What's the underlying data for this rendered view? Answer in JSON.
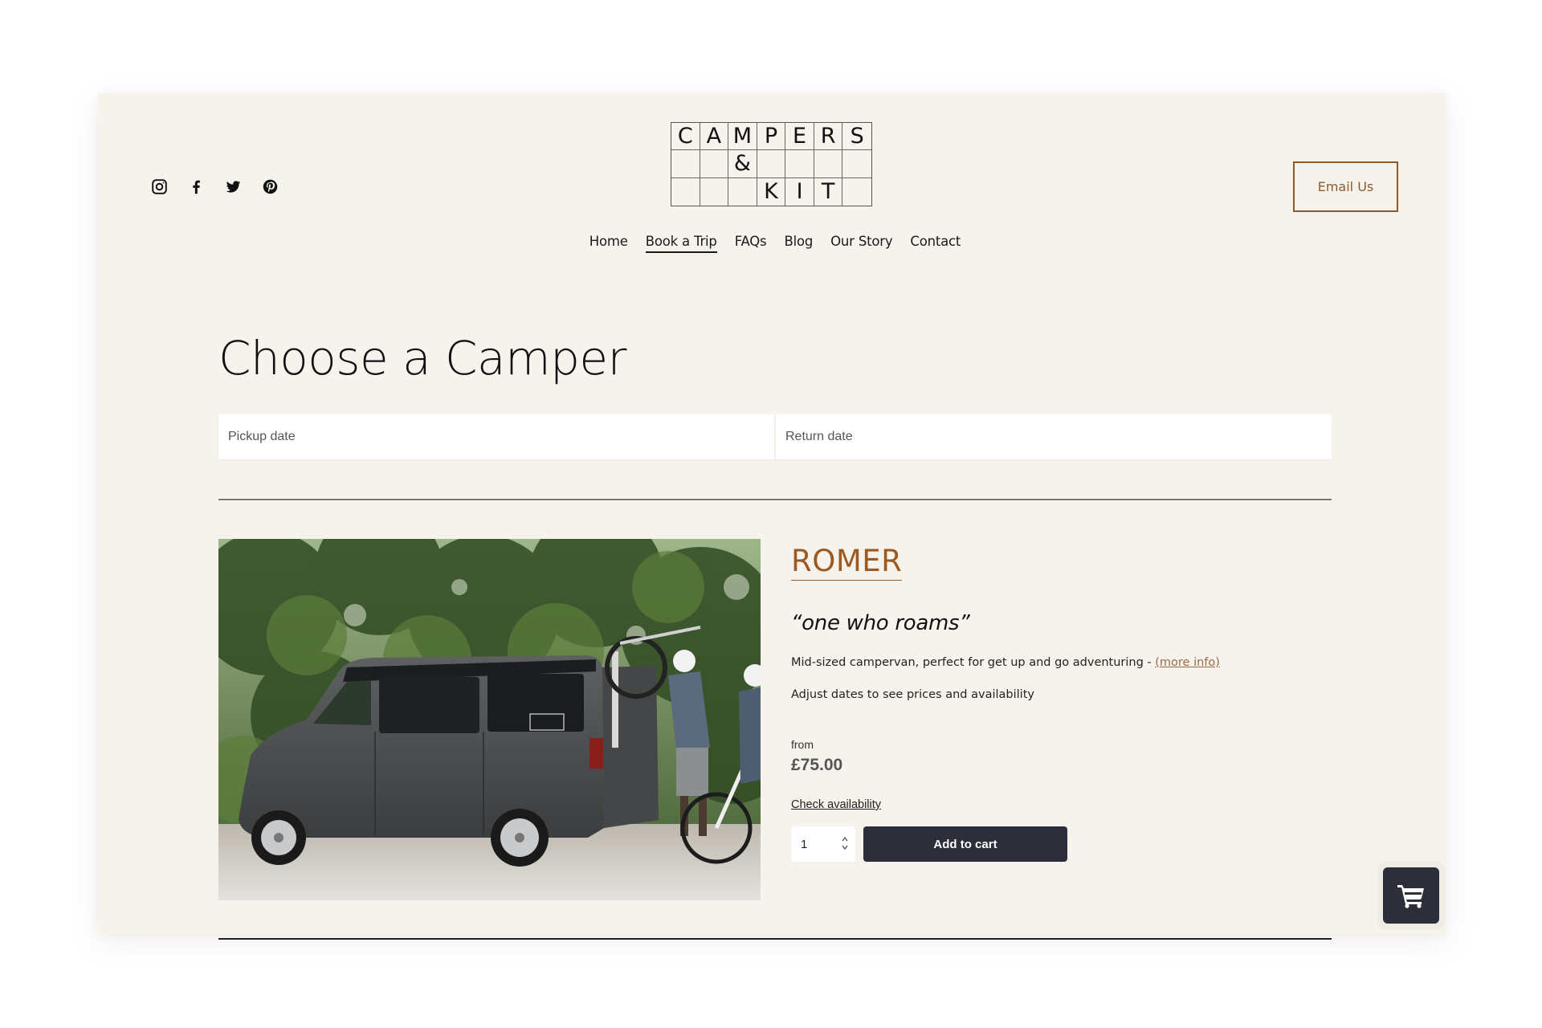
{
  "brand": {
    "logo_rows": [
      [
        "C",
        "A",
        "M",
        "P",
        "E",
        "R",
        "S"
      ],
      [
        "",
        "",
        "&",
        "",
        "",
        "",
        ""
      ],
      [
        "",
        "",
        "",
        "K",
        "I",
        "T",
        ""
      ]
    ]
  },
  "social": [
    {
      "name": "instagram",
      "icon": "instagram-icon"
    },
    {
      "name": "facebook",
      "icon": "facebook-icon"
    },
    {
      "name": "twitter",
      "icon": "twitter-icon"
    },
    {
      "name": "pinterest",
      "icon": "pinterest-icon"
    }
  ],
  "header": {
    "email_label": "Email Us"
  },
  "nav": {
    "items": [
      {
        "label": "Home",
        "active": false
      },
      {
        "label": "Book a Trip",
        "active": true
      },
      {
        "label": "FAQs",
        "active": false
      },
      {
        "label": "Blog",
        "active": false
      },
      {
        "label": "Our Story",
        "active": false
      },
      {
        "label": "Contact",
        "active": false
      }
    ]
  },
  "page": {
    "title": "Choose a Camper"
  },
  "dates": {
    "pickup_placeholder": "Pickup date",
    "pickup_value": "",
    "return_placeholder": "Return date",
    "return_value": ""
  },
  "product": {
    "name": "ROMER",
    "tagline": "“one who roams”",
    "description": "Mid-sized campervan, perfect for get up and go adventuring - ",
    "more_info_label": "(more info)",
    "adjust_note": "Adjust dates to see prices and availability",
    "price_prefix": "from",
    "price": "£75.00",
    "check_availability_label": "Check availability",
    "quantity": "1",
    "add_to_cart_label": "Add to cart",
    "image_alt": "Grey campervan with bike rack in woodland, cyclists loading bikes"
  },
  "colors": {
    "accent": "#9c5a22",
    "button_dark": "#2c2f3a",
    "card_bg": "#f6f2ec"
  }
}
